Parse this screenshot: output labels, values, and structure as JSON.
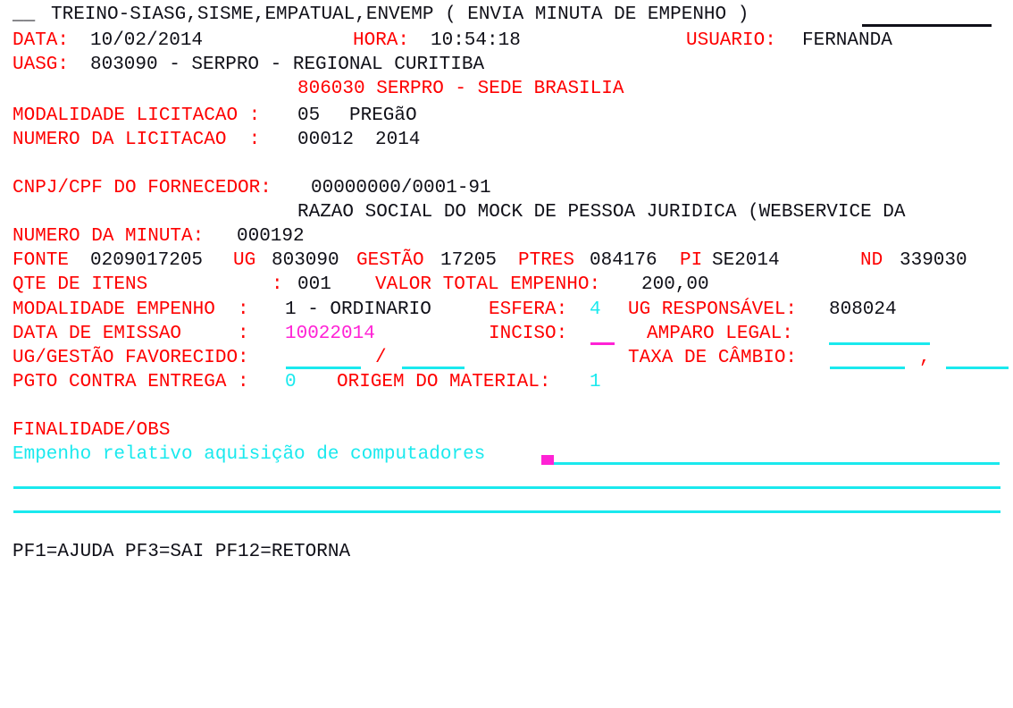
{
  "terminal": {
    "system_title": "TREINO-SIASG,SISME,EMPATUAL,ENVEMP ( ENVIA MINUTA DE EMPENHO )",
    "title_prefix": "__",
    "colors": {
      "label": "#fe0000",
      "value": "#101018",
      "field": "#1ae9ee",
      "cursor": "#ff22d5",
      "background": "#ffffff"
    }
  },
  "header": {
    "data_label": "DATA:",
    "data_value": "10/02/2014",
    "hora_label": "HORA:",
    "hora_value": "10:54:18",
    "usuario_label": "USUARIO:",
    "usuario_value": "FERNANDA",
    "uasg_label": "UASG:",
    "uasg_value": "803090 - SERPRO - REGIONAL CURITIBA",
    "uasg_secondary": "806030 SERPRO - SEDE BRASILIA"
  },
  "licitacao": {
    "modalidade_label": "MODALIDADE LICITACAO :",
    "modalidade_code": "05",
    "modalidade_value": "PREGãO",
    "numero_label": "NUMERO DA LICITACAO  :",
    "numero_value": "00012",
    "numero_ano": "2014"
  },
  "fornecedor": {
    "cnpj_label": "CNPJ/CPF DO FORNECEDOR:",
    "cnpj_value": "00000000/0001-91",
    "razao_social": "RAZAO SOCIAL DO MOCK DE PESSOA JURIDICA (WEBSERVICE DA"
  },
  "minuta": {
    "numero_label": "NUMERO DA MINUTA:",
    "numero_value": "000192"
  },
  "orcamento": {
    "fonte_label": "FONTE",
    "fonte_value": "0209017205",
    "ug_label": "UG",
    "ug_value": "803090",
    "gestao_label": "GESTÃO",
    "gestao_value": "17205",
    "ptres_label": "PTRES",
    "ptres_value": "084176",
    "pi_label": "PI",
    "pi_value": "SE2014",
    "nd_label": "ND",
    "nd_value": "339030"
  },
  "itens": {
    "qte_label": "QTE DE ITENS",
    "qte_colon": ":",
    "qte_value": "001",
    "valor_label": "VALOR TOTAL EMPENHO:",
    "valor_value": "200,00"
  },
  "empenho": {
    "modalidade_label": "MODALIDADE EMPENHO  :",
    "modalidade_value": "1 - ORDINARIO",
    "esfera_label": "ESFERA:",
    "esfera_value": "4",
    "ug_resp_label": "UG RESPONSÁVEL:",
    "ug_resp_value": "808024",
    "emissao_label": "DATA DE EMISSAO     :",
    "emissao_value": "10022014",
    "inciso_label": "INCISO:",
    "inciso_value": "",
    "amparo_label": "AMPARO LEGAL:",
    "amparo_value": "",
    "ug_gestao_label": "UG/GESTÃO FAVORECIDO:",
    "ug_gestao_sep": "/",
    "ug_gestao_value1": "",
    "ug_gestao_value2": "",
    "taxa_label": "TAXA DE CÂMBIO:",
    "taxa_sep": ",",
    "taxa_value1": "",
    "taxa_value2": "",
    "pgto_label": "PGTO CONTRA ENTREGA :",
    "pgto_value": "0",
    "origem_label": "ORIGEM DO MATERIAL:",
    "origem_value": "1"
  },
  "finalidade": {
    "header_label": "FINALIDADE/OBS",
    "line1": "Empenho relativo aquisição de computadores",
    "line2": "",
    "line3": ""
  },
  "footer": {
    "keys": "PF1=AJUDA PF3=SAI PF12=RETORNA"
  }
}
